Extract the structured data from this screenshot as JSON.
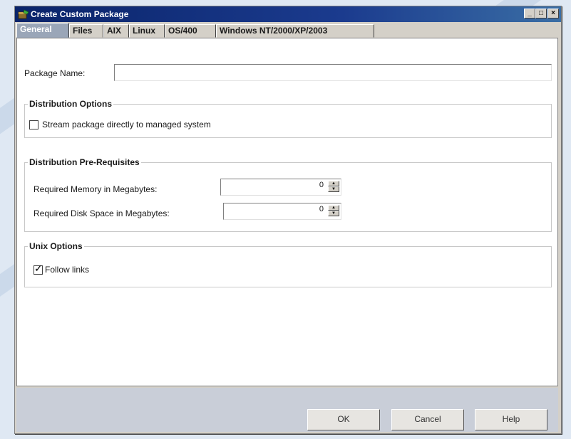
{
  "window": {
    "title": "Create Custom Package",
    "controls": [
      "_",
      "□",
      "×"
    ]
  },
  "tabs": [
    {
      "label": "General",
      "active": true
    },
    {
      "label": "Files"
    },
    {
      "label": "AIX"
    },
    {
      "label": "Linux"
    },
    {
      "label": "OS/400"
    },
    {
      "label": "Windows NT/2000/XP/2003"
    }
  ],
  "general": {
    "package_name_label": "Package Name:",
    "package_name_value": "",
    "distribution_options": {
      "title": "Distribution Options",
      "stream_label": "Stream package directly to managed system",
      "stream_checked": false
    },
    "prerequisites": {
      "title": "Distribution Pre-Requisites",
      "memory_label": "Required Memory in Megabytes:",
      "memory_value": "0",
      "disk_label": "Required Disk Space in Megabytes:",
      "disk_value": "0"
    },
    "unix_options": {
      "title": "Unix Options",
      "follow_links_label": "Follow links",
      "follow_links_checked": true
    }
  },
  "buttons": {
    "ok": "OK",
    "cancel": "Cancel",
    "help": "Help"
  },
  "icons": {
    "app": "package-icon",
    "check": "✓"
  }
}
